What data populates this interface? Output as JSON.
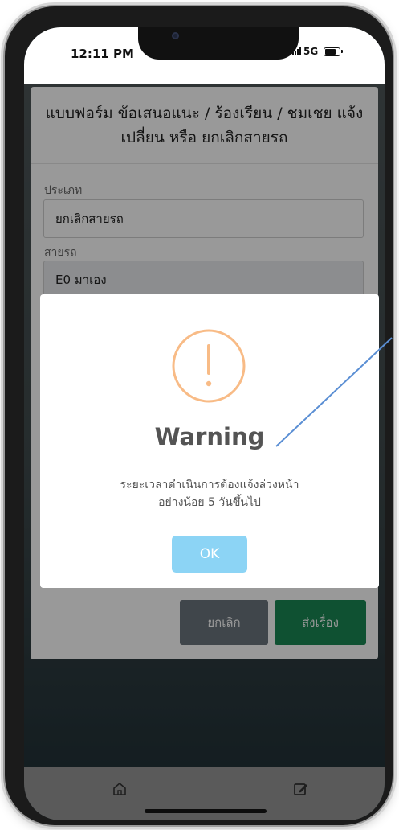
{
  "status_bar": {
    "time": "12:11 PM",
    "network": "5G"
  },
  "form": {
    "title": "แบบฟอร์ม ข้อเสนอแนะ / ร้องเรียน / ชมเชย แจ้งเปลี่ยน หรือ ยกเลิกสายรถ",
    "type_label": "ประเภท",
    "type_value": "ยกเลิกสายรถ",
    "route_label": "สายรถ",
    "route_value": "E0 มาเอง",
    "cancel_label": "ยกเลิก",
    "submit_label": "ส่งเรื่อง"
  },
  "modal": {
    "title": "Warning",
    "message_line1": "ระยะเวลาดำเนินการต้องแจ้งล่วงหน้า",
    "message_line2": "อย่างน้อย 5 วันขึ้นไป",
    "ok_label": "OK",
    "icon": "warning-exclamation-icon"
  },
  "bottom_nav": {
    "items": [
      "home-icon",
      "edit-icon"
    ]
  },
  "colors": {
    "warning": "#f8bb86",
    "ok_button": "#8cd4f5",
    "submit_button": "#198754",
    "cancel_button": "#6c757d",
    "annotation_line": "#5b8fd4"
  }
}
